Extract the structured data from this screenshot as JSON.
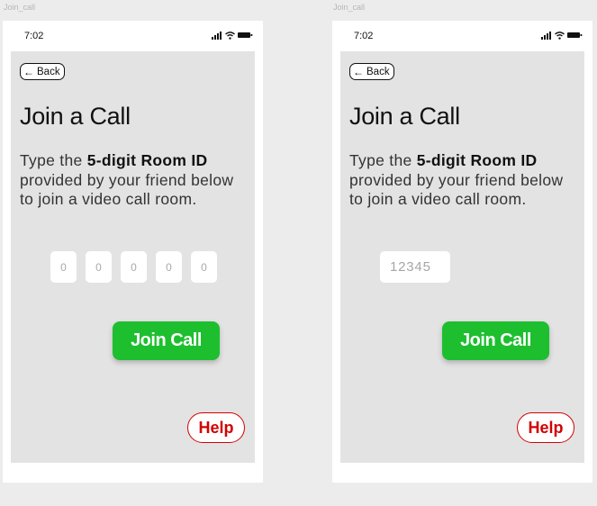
{
  "frames": [
    {
      "label": "Join_call",
      "time": "7:02",
      "back_label": "Back",
      "title": "Join a Call",
      "desc_prefix": "Type the ",
      "desc_bold": "5-digit Room ID",
      "desc_suffix": " provided by your friend below to join a video call room.",
      "digits": [
        "0",
        "0",
        "0",
        "0",
        "0"
      ],
      "join_label": "Join Call",
      "help_label": "Help"
    },
    {
      "label": "Join_call",
      "time": "7:02",
      "back_label": "Back",
      "title": "Join a Call",
      "desc_prefix": "Type the ",
      "desc_bold": "5-digit Room ID",
      "desc_suffix": " provided by your friend below to join a video call room.",
      "room_input_placeholder": "12345",
      "join_label": "Join Call",
      "help_label": "Help"
    }
  ],
  "icons": [
    "signal-icon",
    "wifi-icon",
    "battery-icon",
    "back-arrow-icon"
  ],
  "colors": {
    "canvas": "#ececec",
    "screen": "#e3e3e3",
    "join_button": "#1dbf2f",
    "help_accent": "#d40000"
  }
}
